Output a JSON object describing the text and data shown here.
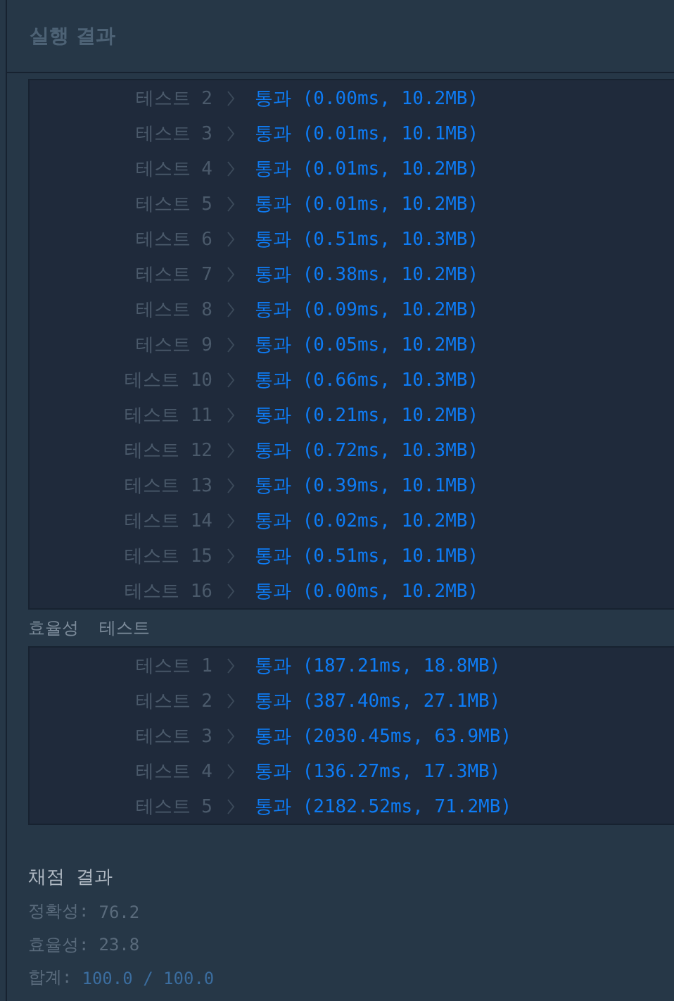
{
  "header": {
    "title": "실행 결과"
  },
  "groups": [
    {
      "tests": [
        {
          "label": "테스트 2",
          "result": "통과 (0.00ms, 10.2MB)"
        },
        {
          "label": "테스트 3",
          "result": "통과 (0.01ms, 10.1MB)"
        },
        {
          "label": "테스트 4",
          "result": "통과 (0.01ms, 10.2MB)"
        },
        {
          "label": "테스트 5",
          "result": "통과 (0.01ms, 10.2MB)"
        },
        {
          "label": "테스트 6",
          "result": "통과 (0.51ms, 10.3MB)"
        },
        {
          "label": "테스트 7",
          "result": "통과 (0.38ms, 10.2MB)"
        },
        {
          "label": "테스트 8",
          "result": "통과 (0.09ms, 10.2MB)"
        },
        {
          "label": "테스트 9",
          "result": "통과 (0.05ms, 10.2MB)"
        },
        {
          "label": "테스트 10",
          "result": "통과 (0.66ms, 10.3MB)"
        },
        {
          "label": "테스트 11",
          "result": "통과 (0.21ms, 10.2MB)"
        },
        {
          "label": "테스트 12",
          "result": "통과 (0.72ms, 10.3MB)"
        },
        {
          "label": "테스트 13",
          "result": "통과 (0.39ms, 10.1MB)"
        },
        {
          "label": "테스트 14",
          "result": "통과 (0.02ms, 10.2MB)"
        },
        {
          "label": "테스트 15",
          "result": "통과 (0.51ms, 10.1MB)"
        },
        {
          "label": "테스트 16",
          "result": "통과 (0.00ms, 10.2MB)"
        }
      ]
    },
    {
      "title": "효율성  테스트",
      "tests": [
        {
          "label": "테스트 1",
          "result": "통과 (187.21ms, 18.8MB)"
        },
        {
          "label": "테스트 2",
          "result": "통과 (387.40ms, 27.1MB)"
        },
        {
          "label": "테스트 3",
          "result": "통과 (2030.45ms, 63.9MB)"
        },
        {
          "label": "테스트 4",
          "result": "통과 (136.27ms, 17.3MB)"
        },
        {
          "label": "테스트 5",
          "result": "통과 (2182.52ms, 71.2MB)"
        }
      ]
    }
  ],
  "grading": {
    "title": "채점 결과",
    "lines": [
      {
        "label": "정확성:",
        "value": "76.2",
        "kind": "score"
      },
      {
        "label": "효율성:",
        "value": "23.8",
        "kind": "score"
      },
      {
        "label": "합계:",
        "value": "100.0 / 100.0",
        "kind": "total"
      }
    ]
  }
}
